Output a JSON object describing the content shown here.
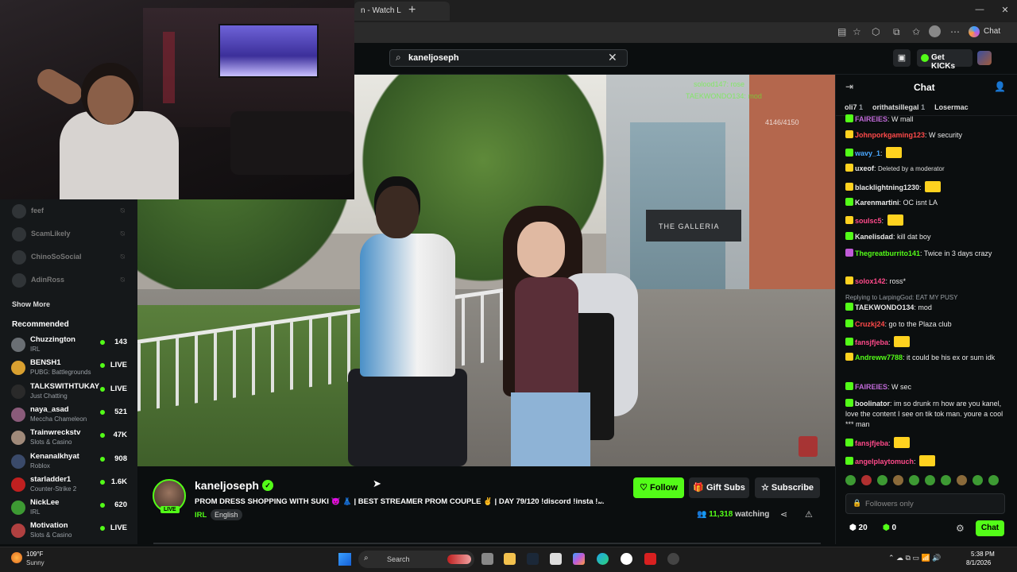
{
  "browser": {
    "tab_title": "n - Watch L",
    "copilot_label": "Chat",
    "window_controls": [
      "—",
      "▢",
      "✕"
    ]
  },
  "header": {
    "search_value": "kaneljoseph",
    "get_kicks_label": "Get KICKs"
  },
  "sidebar": {
    "followed": [
      {
        "name": "feef"
      },
      {
        "name": "ScamLikely"
      },
      {
        "name": "ChinoSoSocial"
      },
      {
        "name": "AdinRoss"
      }
    ],
    "show_more": "Show More",
    "recommended_title": "Recommended",
    "recommended": [
      {
        "name": "Chuzzington",
        "category": "IRL",
        "viewers": "143",
        "color": "#6a6f74"
      },
      {
        "name": "BENSH1",
        "category": "PUBG: Battlegrounds",
        "viewers": "LIVE",
        "color": "#d9a030"
      },
      {
        "name": "TALKSWITHTUKAY",
        "category": "Just Chatting",
        "viewers": "LIVE",
        "color": "#2a2a2a"
      },
      {
        "name": "naya_asad",
        "category": "Meccha Chameleon",
        "viewers": "521",
        "color": "#8a5b7a"
      },
      {
        "name": "Trainwreckstv",
        "category": "Slots & Casino",
        "viewers": "47K",
        "color": "#a08a7a"
      },
      {
        "name": "Kenanalkhyat",
        "category": "Roblox",
        "viewers": "908",
        "color": "#3a4a6a"
      },
      {
        "name": "starladder1",
        "category": "Counter-Strike 2",
        "viewers": "1.6K",
        "color": "#c02020"
      },
      {
        "name": "NickLee",
        "category": "IRL",
        "viewers": "620",
        "color": "#3d9a33"
      },
      {
        "name": "Motivation",
        "category": "Slots & Casino",
        "viewers": "LIVE",
        "color": "#b04040"
      }
    ]
  },
  "video": {
    "overlay_line1": "solood147: rose",
    "overlay_line2": "TAEKWONDO134: mod",
    "counter": "4146/4150",
    "sign_text": "THE GALLERIA"
  },
  "stream": {
    "channel_name": "kaneljoseph",
    "live_badge": "LIVE",
    "title": "PROM DRESS SHOPPING WITH SUKI 😈 👗 | BEST STREAMER PROM COUPLE ✌ | DAY 79/120 !discord !insta !...",
    "category": "IRL",
    "language": "English",
    "follow_label": "Follow",
    "gift_label": "Gift Subs",
    "subscribe_label": "Subscribe",
    "viewers": "11,318",
    "watching_label": "watching"
  },
  "chat": {
    "title": "Chat",
    "top_gifters": [
      {
        "name": "oli7",
        "count": "1"
      },
      {
        "name": "orithatsillegal",
        "count": "1"
      },
      {
        "name": "Losermac",
        "count": ""
      }
    ],
    "messages": [
      {
        "user": "FAIREIES",
        "color": "#c06ad8",
        "text": "W mall"
      },
      {
        "user": "Johnporkgaming123",
        "color": "#ff4a4a",
        "text": "W security"
      },
      {
        "user": "wavy_1",
        "color": "#4aa8ff",
        "text": ""
      },
      {
        "user": "uxeof",
        "color": "#e8e8e8",
        "text": "Deleted by a moderator"
      },
      {
        "user": "blacklightning1230",
        "color": "#e8e8e8",
        "text": ""
      },
      {
        "user": "Karenmartini",
        "color": "#e8e8e8",
        "text": "OC isnt LA"
      },
      {
        "user": "soulsc5",
        "color": "#ff4a8a",
        "text": ""
      },
      {
        "user": "Kanelisdad",
        "color": "#e8e8e8",
        "text": "kill dat boy"
      },
      {
        "user": "Thegreatburrito141",
        "color": "#53fc18",
        "text": "Twice in 3 days crazy"
      },
      {
        "user": "solox142",
        "color": "#ff4a8a",
        "text": "ross*"
      },
      {
        "user": "TAEKWONDO134",
        "color": "#e8e8e8",
        "text": "mod",
        "reply": "Replying to LarpingGod: EAT MY PUSY"
      },
      {
        "user": "Cruzkj24",
        "color": "#ff4a4a",
        "text": "go to the Plaza club"
      },
      {
        "user": "fansjfjeba",
        "color": "#ff4a8a",
        "text": ""
      },
      {
        "user": "Andreww7788",
        "color": "#53fc18",
        "text": "it could be his ex or sum idk"
      },
      {
        "user": "FAIREIES",
        "color": "#c06ad8",
        "text": "W sec"
      },
      {
        "user": "boolinator",
        "color": "#e8e8e8",
        "text": "im so drunk rn how are you kanel, love the content I see on tik tok man. youre a cool *** man"
      },
      {
        "user": "fansjfjeba",
        "color": "#ff4a8a",
        "text": ""
      },
      {
        "user": "angelplaytomuch",
        "color": "#ff4a8a",
        "text": ""
      }
    ],
    "input_placeholder": "Followers only",
    "points_a": "20",
    "points_b": "0",
    "send_label": "Chat"
  },
  "taskbar": {
    "weather_temp": "109°F",
    "weather_desc": "Sunny",
    "search_label": "Search",
    "time": "5:38 PM",
    "date": "8/1/2026"
  }
}
